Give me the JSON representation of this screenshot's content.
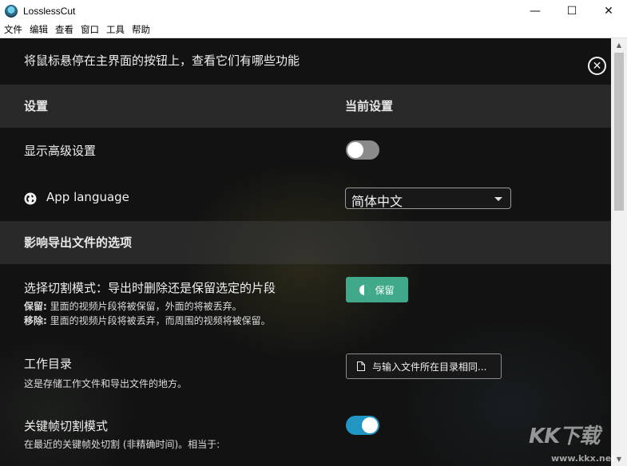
{
  "window": {
    "title": "LosslessCut",
    "controls": {
      "minimize": "—",
      "maximize": "☐",
      "close": "✕"
    }
  },
  "menu": [
    "文件",
    "编辑",
    "查看",
    "窗口",
    "工具",
    "帮助"
  ],
  "settings": {
    "hint": "将鼠标悬停在主界面的按钮上，查看它们有哪些功能",
    "close_icon": "✕",
    "header_setting": "设置",
    "header_current": "当前设置",
    "advanced": {
      "label": "显示高级设置",
      "enabled": false
    },
    "language": {
      "label": "App language",
      "value": "简体中文"
    },
    "export_section": "影响导出文件的选项",
    "cut_mode": {
      "label": "选择切割模式：导出时删除还是保留选定的片段",
      "keep_term": "保留:",
      "keep_desc": " 里面的视频片段将被保留，外面的将被丢弃。",
      "remove_term": "移除:",
      "remove_desc": " 里面的视频片段将被丢弃，而周围的视频将被保留。",
      "button": "保留"
    },
    "working_dir": {
      "label": "工作目录",
      "desc": "这是存储工作文件和导出文件的地方。",
      "button": "与输入文件所在目录相同..."
    },
    "keyframe": {
      "label": "关键帧切割模式",
      "desc": "在最近的关键帧处切割 (非精确时间)。相当于:",
      "enabled": true
    }
  },
  "watermark": {
    "text": "KK下载",
    "url": "www.kkx.net"
  },
  "colors": {
    "toggle_on": "#2196c3",
    "keep_button": "#3fa98a",
    "background": "#121212"
  }
}
